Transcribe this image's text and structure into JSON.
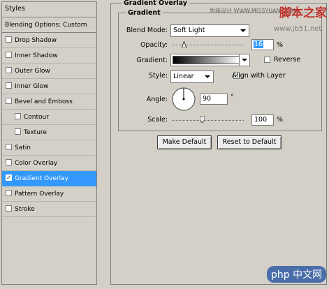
{
  "sidebar": {
    "title": "Styles",
    "blending_options": "Blending Options: Custom",
    "items": [
      {
        "label": "Drop Shadow",
        "checked": false,
        "indent": false,
        "selected": false
      },
      {
        "label": "Inner Shadow",
        "checked": false,
        "indent": false,
        "selected": false
      },
      {
        "label": "Outer Glow",
        "checked": false,
        "indent": false,
        "selected": false
      },
      {
        "label": "Inner Glow",
        "checked": false,
        "indent": false,
        "selected": false
      },
      {
        "label": "Bevel and Emboss",
        "checked": false,
        "indent": false,
        "selected": false
      },
      {
        "label": "Contour",
        "checked": false,
        "indent": true,
        "selected": false
      },
      {
        "label": "Texture",
        "checked": false,
        "indent": true,
        "selected": false
      },
      {
        "label": "Satin",
        "checked": false,
        "indent": false,
        "selected": false
      },
      {
        "label": "Color Overlay",
        "checked": false,
        "indent": false,
        "selected": false
      },
      {
        "label": "Gradient Overlay",
        "checked": true,
        "indent": false,
        "selected": true
      },
      {
        "label": "Pattern Overlay",
        "checked": false,
        "indent": false,
        "selected": false
      },
      {
        "label": "Stroke",
        "checked": false,
        "indent": false,
        "selected": false
      }
    ]
  },
  "panel": {
    "title": "Gradient Overlay",
    "subtitle": "Gradient",
    "blend_mode_label": "Blend Mode:",
    "blend_mode_value": "Soft Light",
    "opacity_label": "Opacity:",
    "opacity_value": "16",
    "opacity_unit": "%",
    "opacity_fraction": 0.16,
    "gradient_label": "Gradient:",
    "reverse_label": "Reverse",
    "reverse_checked": false,
    "style_label": "Style:",
    "style_value": "Linear",
    "align_label": "Align with Layer",
    "align_checked": true,
    "angle_label": "Angle:",
    "angle_value": "90",
    "angle_unit": "°",
    "angle_degrees": 90,
    "scale_label": "Scale:",
    "scale_value": "100",
    "scale_unit": "%",
    "scale_fraction": 0.42,
    "make_default": "Make Default",
    "reset_default": "Reset to Default"
  },
  "watermarks": {
    "top": "思缘设计 WWW.MISSYUAN.COM",
    "top_brand": "脚本之家",
    "url": "www.jb51.net",
    "bottom_brand": "php 中文网"
  },
  "colors": {
    "selected_bg": "#3399ff",
    "window_bg": "#d4d0c8",
    "watermark_red": "#c0312b"
  }
}
